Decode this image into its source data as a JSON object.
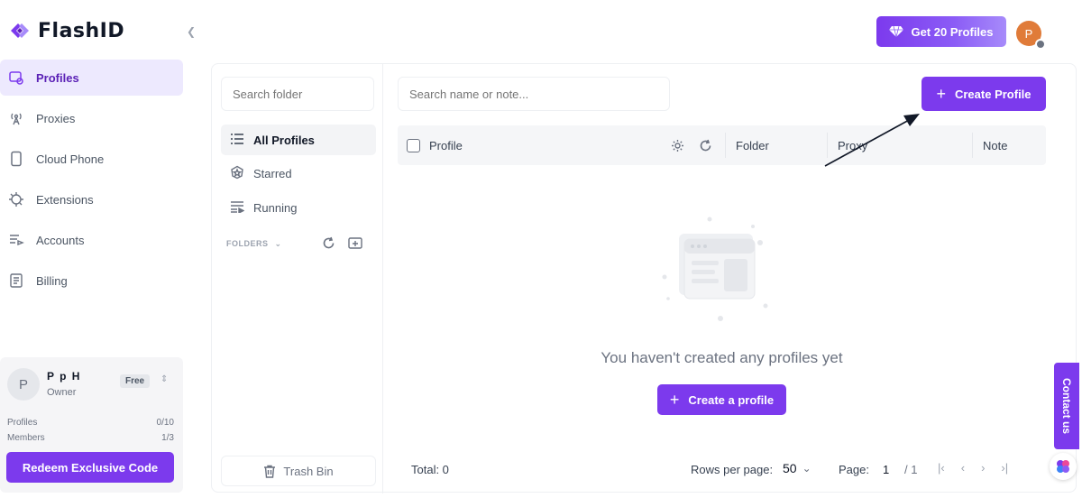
{
  "app": {
    "name": "FlashID"
  },
  "sidebar": {
    "items": [
      {
        "label": "Profiles",
        "icon": "profiles-icon",
        "active": true
      },
      {
        "label": "Proxies",
        "icon": "proxy-antenna-icon"
      },
      {
        "label": "Cloud Phone",
        "icon": "phone-icon"
      },
      {
        "label": "Extensions",
        "icon": "extension-icon"
      },
      {
        "label": "Accounts",
        "icon": "accounts-icon"
      },
      {
        "label": "Billing",
        "icon": "billing-icon"
      }
    ],
    "account": {
      "avatar_letter": "P",
      "name": "P p H",
      "role": "Owner",
      "plan": "Free",
      "stats": [
        {
          "label": "Profiles",
          "value": "0/10"
        },
        {
          "label": "Members",
          "value": "1/3"
        }
      ],
      "redeem_label": "Redeem Exclusive Code"
    }
  },
  "topbar": {
    "upgrade_label": "Get 20 Profiles",
    "user_avatar_letter": "P"
  },
  "folders": {
    "search_placeholder": "Search folder",
    "items": [
      {
        "label": "All Profiles",
        "active": true
      },
      {
        "label": "Starred"
      },
      {
        "label": "Running"
      }
    ],
    "section_label": "FOLDERS",
    "trash_label": "Trash Bin"
  },
  "profiles": {
    "search_placeholder": "Search name or note...",
    "create_label": "Create Profile",
    "columns": [
      "Profile",
      "Folder",
      "Proxy",
      "Note"
    ],
    "empty_message": "You haven't created any profiles yet",
    "empty_action": "Create a profile"
  },
  "footer": {
    "total": "Total: 0",
    "rows_label": "Rows per page:",
    "rows_value": "50",
    "page_label": "Page:",
    "page_current": "1",
    "page_total": "/ 1"
  },
  "contact": {
    "label": "Contact us"
  },
  "colors": {
    "accent": "#7c3aed",
    "accent_light": "#ede9fe",
    "avatar": "#e07b39"
  }
}
